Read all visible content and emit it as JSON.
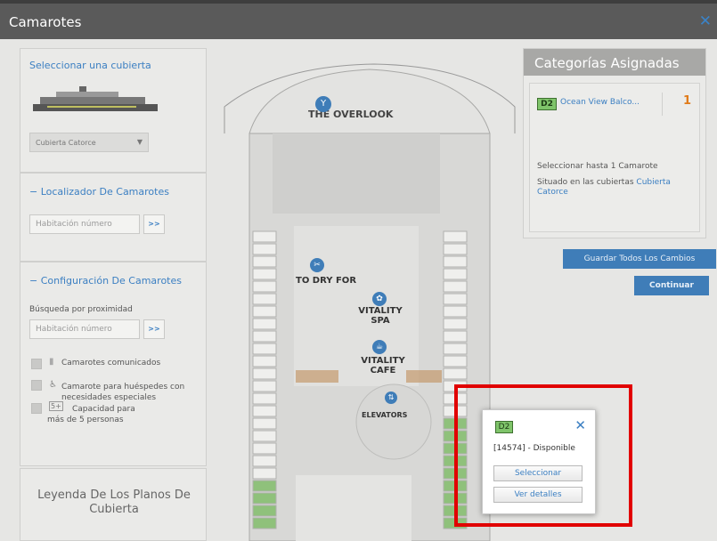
{
  "window": {
    "title": "Camarotes",
    "close_icon": "close-icon"
  },
  "left": {
    "select_deck_label": "Seleccionar una cubierta",
    "deck_dropdown_value": "Cubierta Catorce",
    "locator": {
      "title": "Localizador De Camarotes",
      "placeholder": "Habitación número",
      "go": ">>"
    },
    "config": {
      "title": "Configuración De Camarotes",
      "proximity_label": "Búsqueda por proximidad",
      "placeholder": "Habitación número",
      "go": ">>",
      "options": [
        {
          "label": "Camarotes comunicados",
          "icon": "connecting-doors-icon"
        },
        {
          "label": "Camarote para huéspedes con necesidades especiales",
          "icon": "accessible-icon"
        },
        {
          "label": "Capacidad para",
          "label2": "más de 5 personas",
          "icon": "capacity-icon"
        }
      ]
    },
    "legend_title": "Leyenda De Los Planos De Cubierta"
  },
  "deck": {
    "overlook": "THE OVERLOOK",
    "to_dry_for": "TO DRY FOR",
    "vitality_spa": "VITALITY SPA",
    "vitality_cafe": "VITALITY CAFE",
    "elevators": "ELEVATORS"
  },
  "right": {
    "title": "Categorías Asignadas",
    "category_code": "D2",
    "category_name": "Ocean View Balco...",
    "category_count": "1",
    "select_up_to": "Seleccionar hasta 1 Camarote",
    "located_prefix": "Situado en las cubiertas",
    "located_deck": "Cubierta Catorce",
    "save_all": "Guardar Todos Los Cambios",
    "continue": "Continuar"
  },
  "popup": {
    "code": "D2",
    "cabin_status": "[14574] - Disponible",
    "select": "Seleccionar",
    "details": "Ver detalles"
  },
  "colors": {
    "accent": "#3b7fc2",
    "highlight": "#e10000",
    "orange": "#e07b1a",
    "green_badge": "#7fc46a"
  }
}
